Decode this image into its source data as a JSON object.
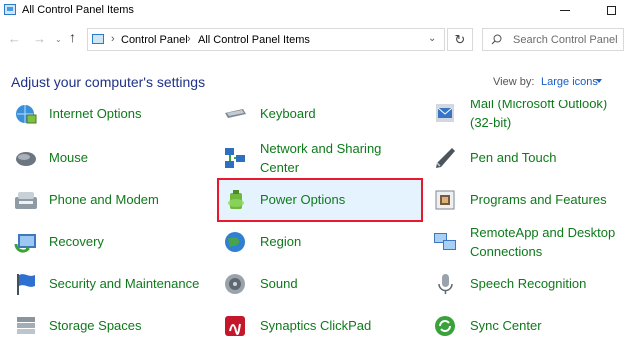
{
  "window": {
    "title": "All Control Panel Items"
  },
  "nav": {
    "back_icon": "arrow-left-icon",
    "forward_icon": "arrow-right-icon",
    "up_icon": "arrow-up-icon",
    "breadcrumb": [
      "Control Panel",
      "All Control Panel Items"
    ],
    "search_placeholder": "Search Control Panel"
  },
  "header": {
    "title": "Adjust your computer's settings",
    "view_by_label": "View by:",
    "view_by_value": "Large icons"
  },
  "colors": {
    "item_text": "#0e7a1b",
    "title_text": "#1e3287",
    "link": "#1a5ec7",
    "selection_border": "#e8192c",
    "selection_fill": "#e5f3ff"
  },
  "items": {
    "col1": [
      {
        "label": "Internet Options",
        "icon": "internet-options-icon"
      },
      {
        "label": "Mouse",
        "icon": "mouse-icon"
      },
      {
        "label": "Phone and Modem",
        "icon": "phone-modem-icon"
      },
      {
        "label": "Recovery",
        "icon": "recovery-icon"
      },
      {
        "label": "Security and Maintenance",
        "icon": "security-flag-icon"
      },
      {
        "label": "Storage Spaces",
        "icon": "storage-spaces-icon"
      }
    ],
    "col2": [
      {
        "label": "Keyboard",
        "icon": "keyboard-icon"
      },
      {
        "label_line1": "Network and Sharing",
        "label_line2": "Center",
        "icon": "network-sharing-icon"
      },
      {
        "label": "Power Options",
        "icon": "power-options-icon",
        "selected": true
      },
      {
        "label": "Region",
        "icon": "region-globe-icon"
      },
      {
        "label": "Sound",
        "icon": "sound-speaker-icon"
      },
      {
        "label": "Synaptics ClickPad",
        "icon": "synaptics-icon"
      }
    ],
    "col3": [
      {
        "label_line1": "Mail (Microsoft Outlook)",
        "label_line2": "(32-bit)",
        "icon": "mail-icon"
      },
      {
        "label": "Pen and Touch",
        "icon": "pen-icon"
      },
      {
        "label": "Programs and Features",
        "icon": "programs-features-icon"
      },
      {
        "label_line1": "RemoteApp and Desktop",
        "label_line2": "Connections",
        "icon": "remoteapp-icon"
      },
      {
        "label": "Speech Recognition",
        "icon": "microphone-icon"
      },
      {
        "label": "Sync Center",
        "icon": "sync-center-icon"
      }
    ]
  }
}
